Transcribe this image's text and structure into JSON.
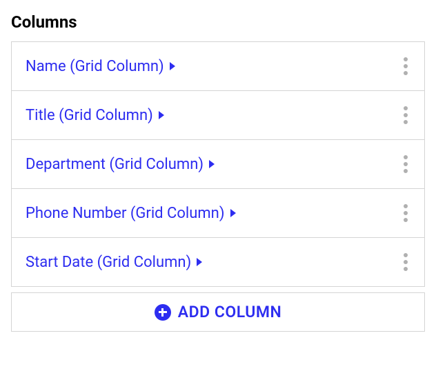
{
  "section": {
    "title": "Columns",
    "add_label": "ADD COLUMN"
  },
  "columns": [
    {
      "label": "Name (Grid Column)"
    },
    {
      "label": "Title (Grid Column)"
    },
    {
      "label": "Department (Grid Column)"
    },
    {
      "label": "Phone Number (Grid Column)"
    },
    {
      "label": "Start Date (Grid Column)"
    }
  ]
}
